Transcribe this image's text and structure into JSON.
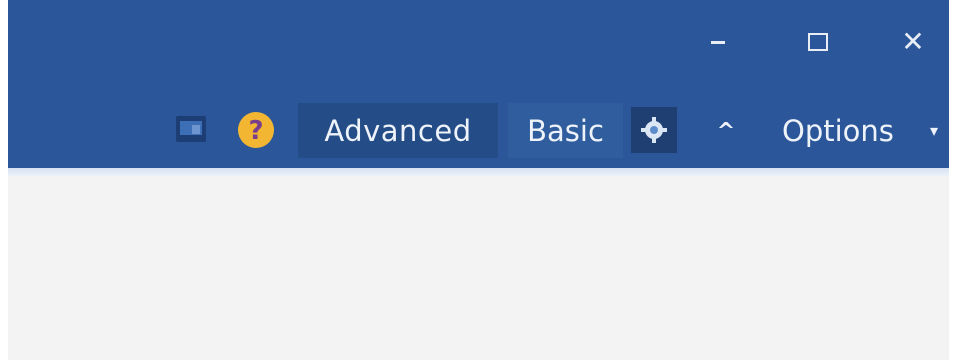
{
  "window_controls": {
    "minimize_icon": "minimize-icon",
    "maximize_icon": "maximize-icon",
    "close_glyph": "✕"
  },
  "toolbar": {
    "advanced_label": "Advanced",
    "basic_label": "Basic",
    "options_label": "Options",
    "collapse_glyph": "^",
    "options_caret_glyph": "▾",
    "help_glyph": "?"
  },
  "colors": {
    "title_bar": "#2b579a",
    "active_tab": "#244c86",
    "help_icon": "#f2b632",
    "content": "#f3f3f3"
  }
}
